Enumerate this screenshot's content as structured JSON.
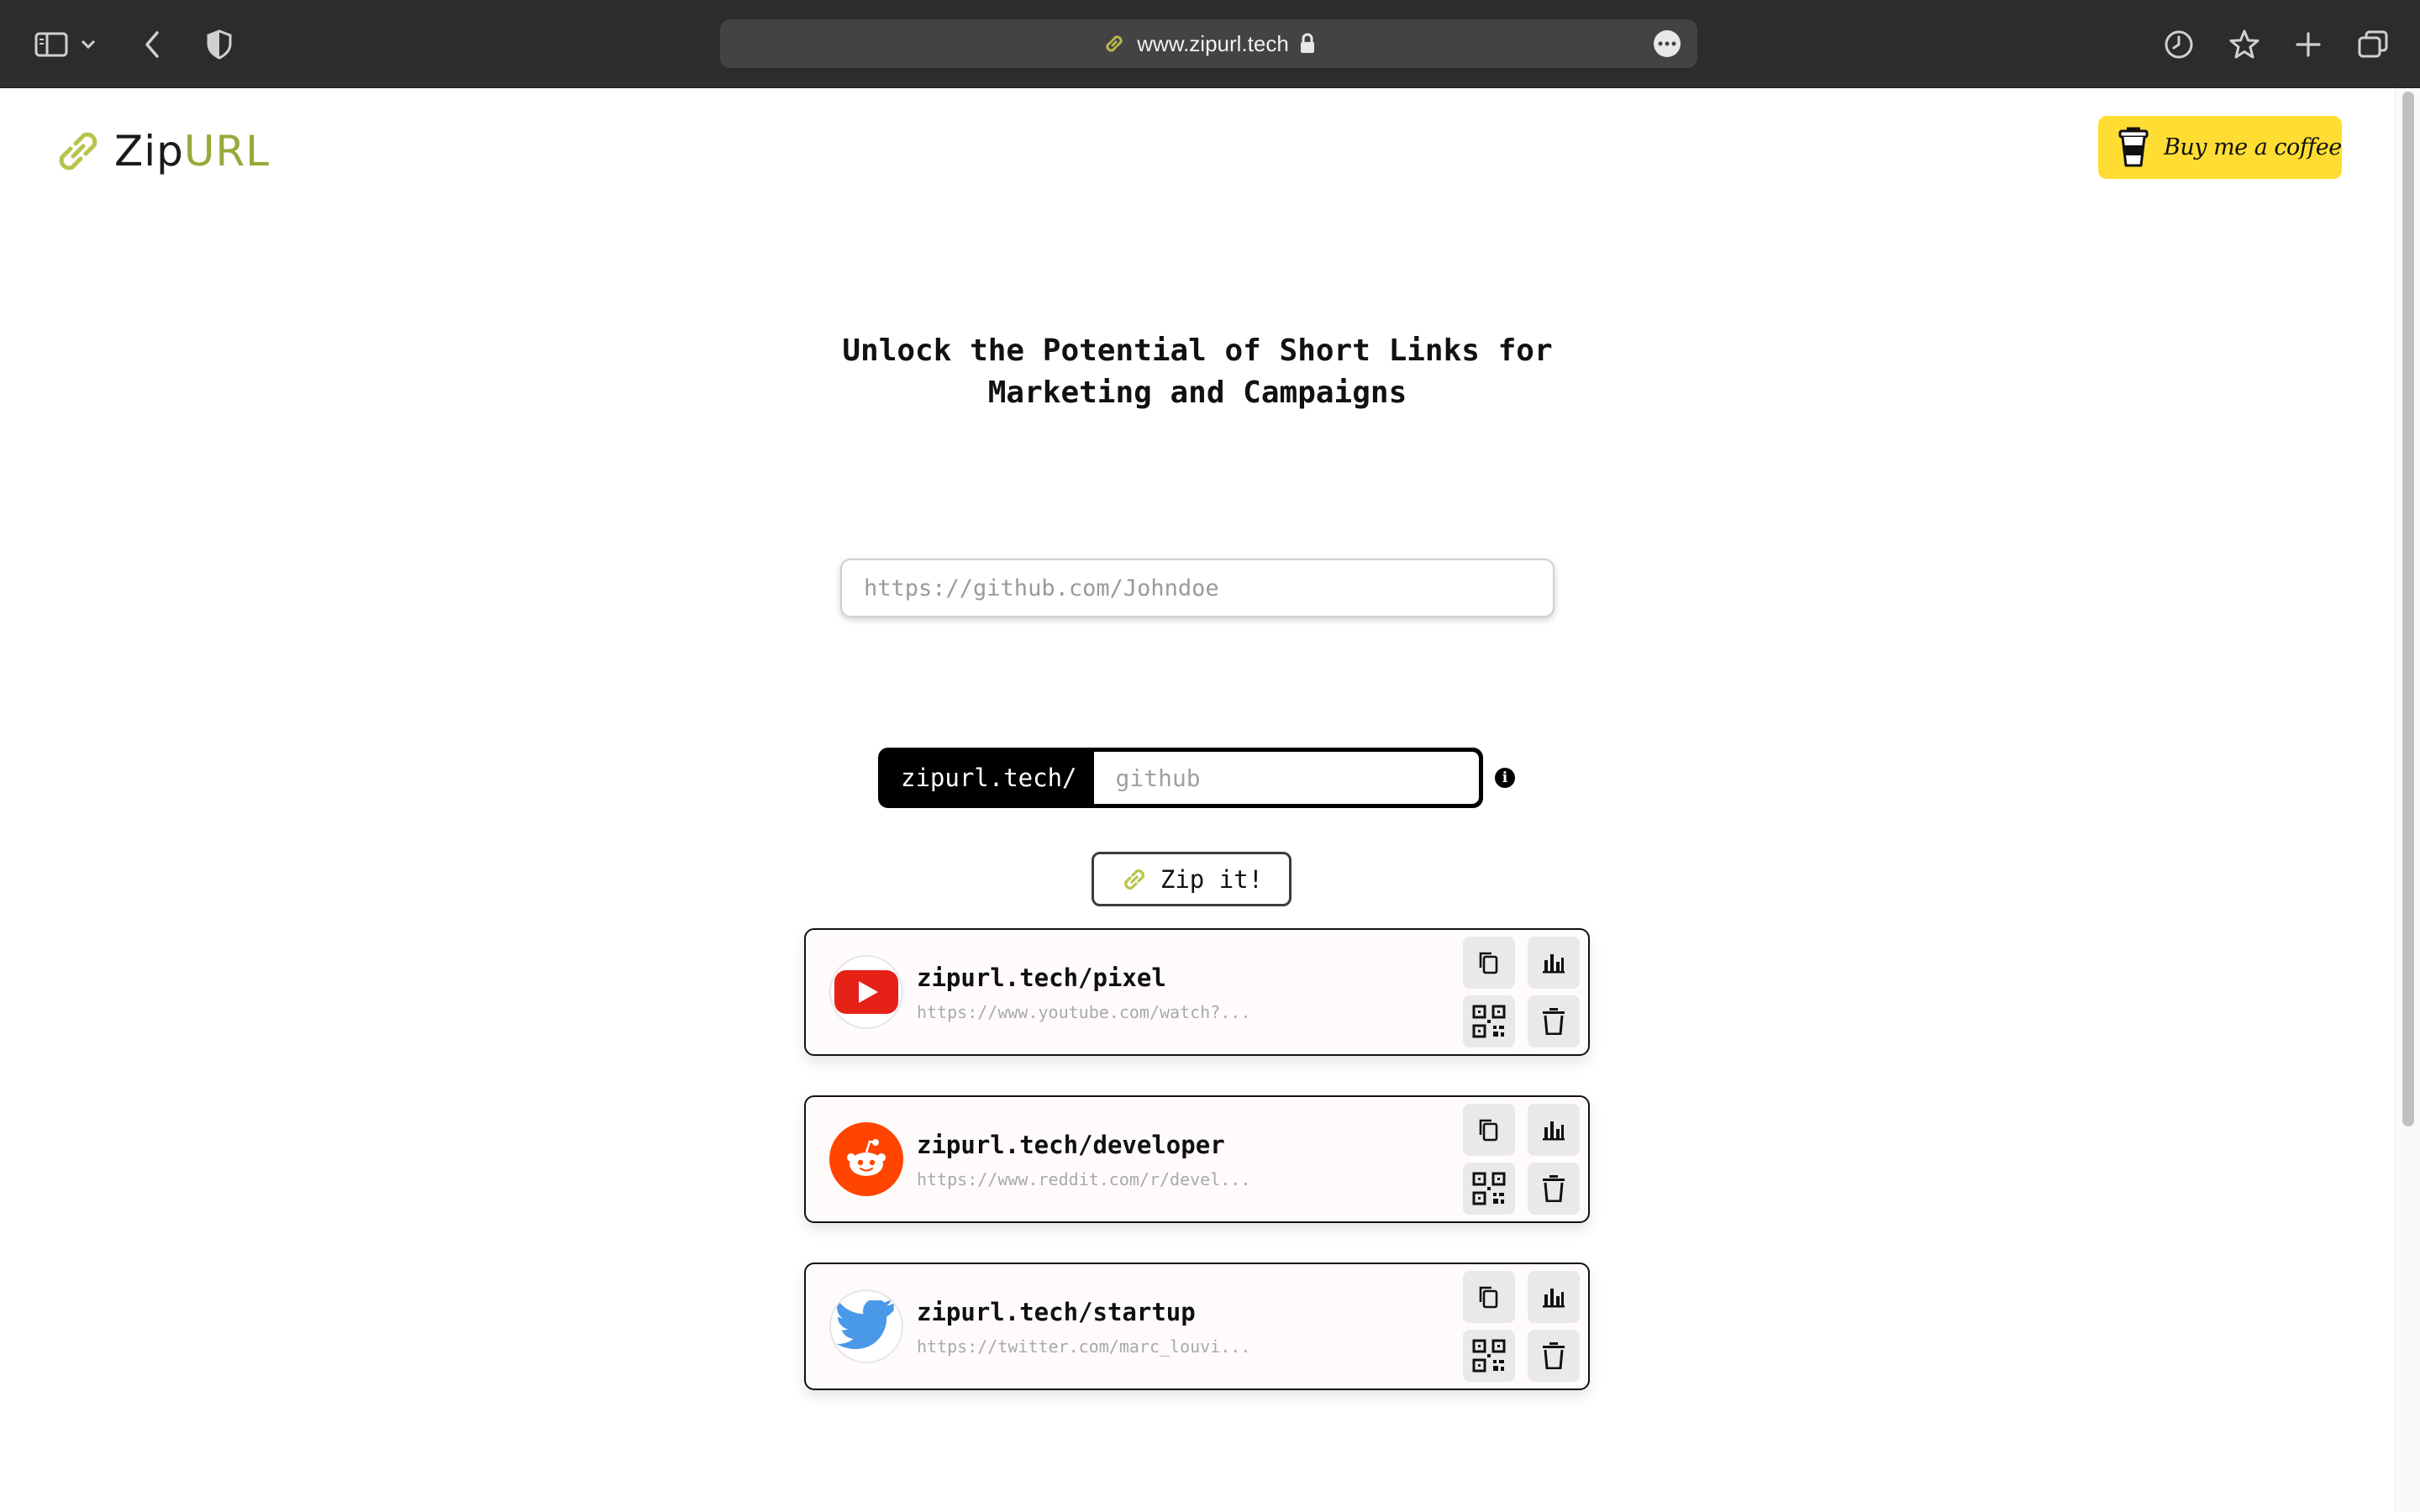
{
  "browser": {
    "url": "www.zipurl.tech",
    "controls": {
      "sidebar": "sidebar-icon",
      "back": "chevron-left-icon",
      "shield": "shield-icon",
      "history": "clock-icon",
      "bookmark": "star-icon",
      "new_tab": "plus-icon",
      "tabs": "tabs-overview-icon"
    }
  },
  "header": {
    "logo_zip": "Zip",
    "logo_url": "URL",
    "coffee_label": "Buy me a coffee"
  },
  "hero": {
    "headline_line1": "Unlock the Potential of Short Links for",
    "headline_line2": "Marketing and Campaigns"
  },
  "form": {
    "long_url_placeholder": "https://github.com/Johndoe",
    "long_url_value": "",
    "alias_prefix": "zipurl.tech/",
    "alias_placeholder": "github",
    "alias_value": "",
    "submit_label": "Zip it!"
  },
  "links": [
    {
      "short": "zipurl.tech/pixel",
      "long": "https://www.youtube.com/watch?...",
      "service": "youtube-logo-icon"
    },
    {
      "short": "zipurl.tech/developer",
      "long": "https://www.reddit.com/r/devel...",
      "service": "reddit-logo-icon"
    },
    {
      "short": "zipurl.tech/startup",
      "long": "https://twitter.com/marc_louvi...",
      "service": "twitter-logo-icon"
    }
  ],
  "colors": {
    "brand_accent": "#9aa83a",
    "coffee_bg": "#ffdd33",
    "youtube": "#e62117",
    "reddit": "#ff4500",
    "twitter": "#4a99e9"
  }
}
